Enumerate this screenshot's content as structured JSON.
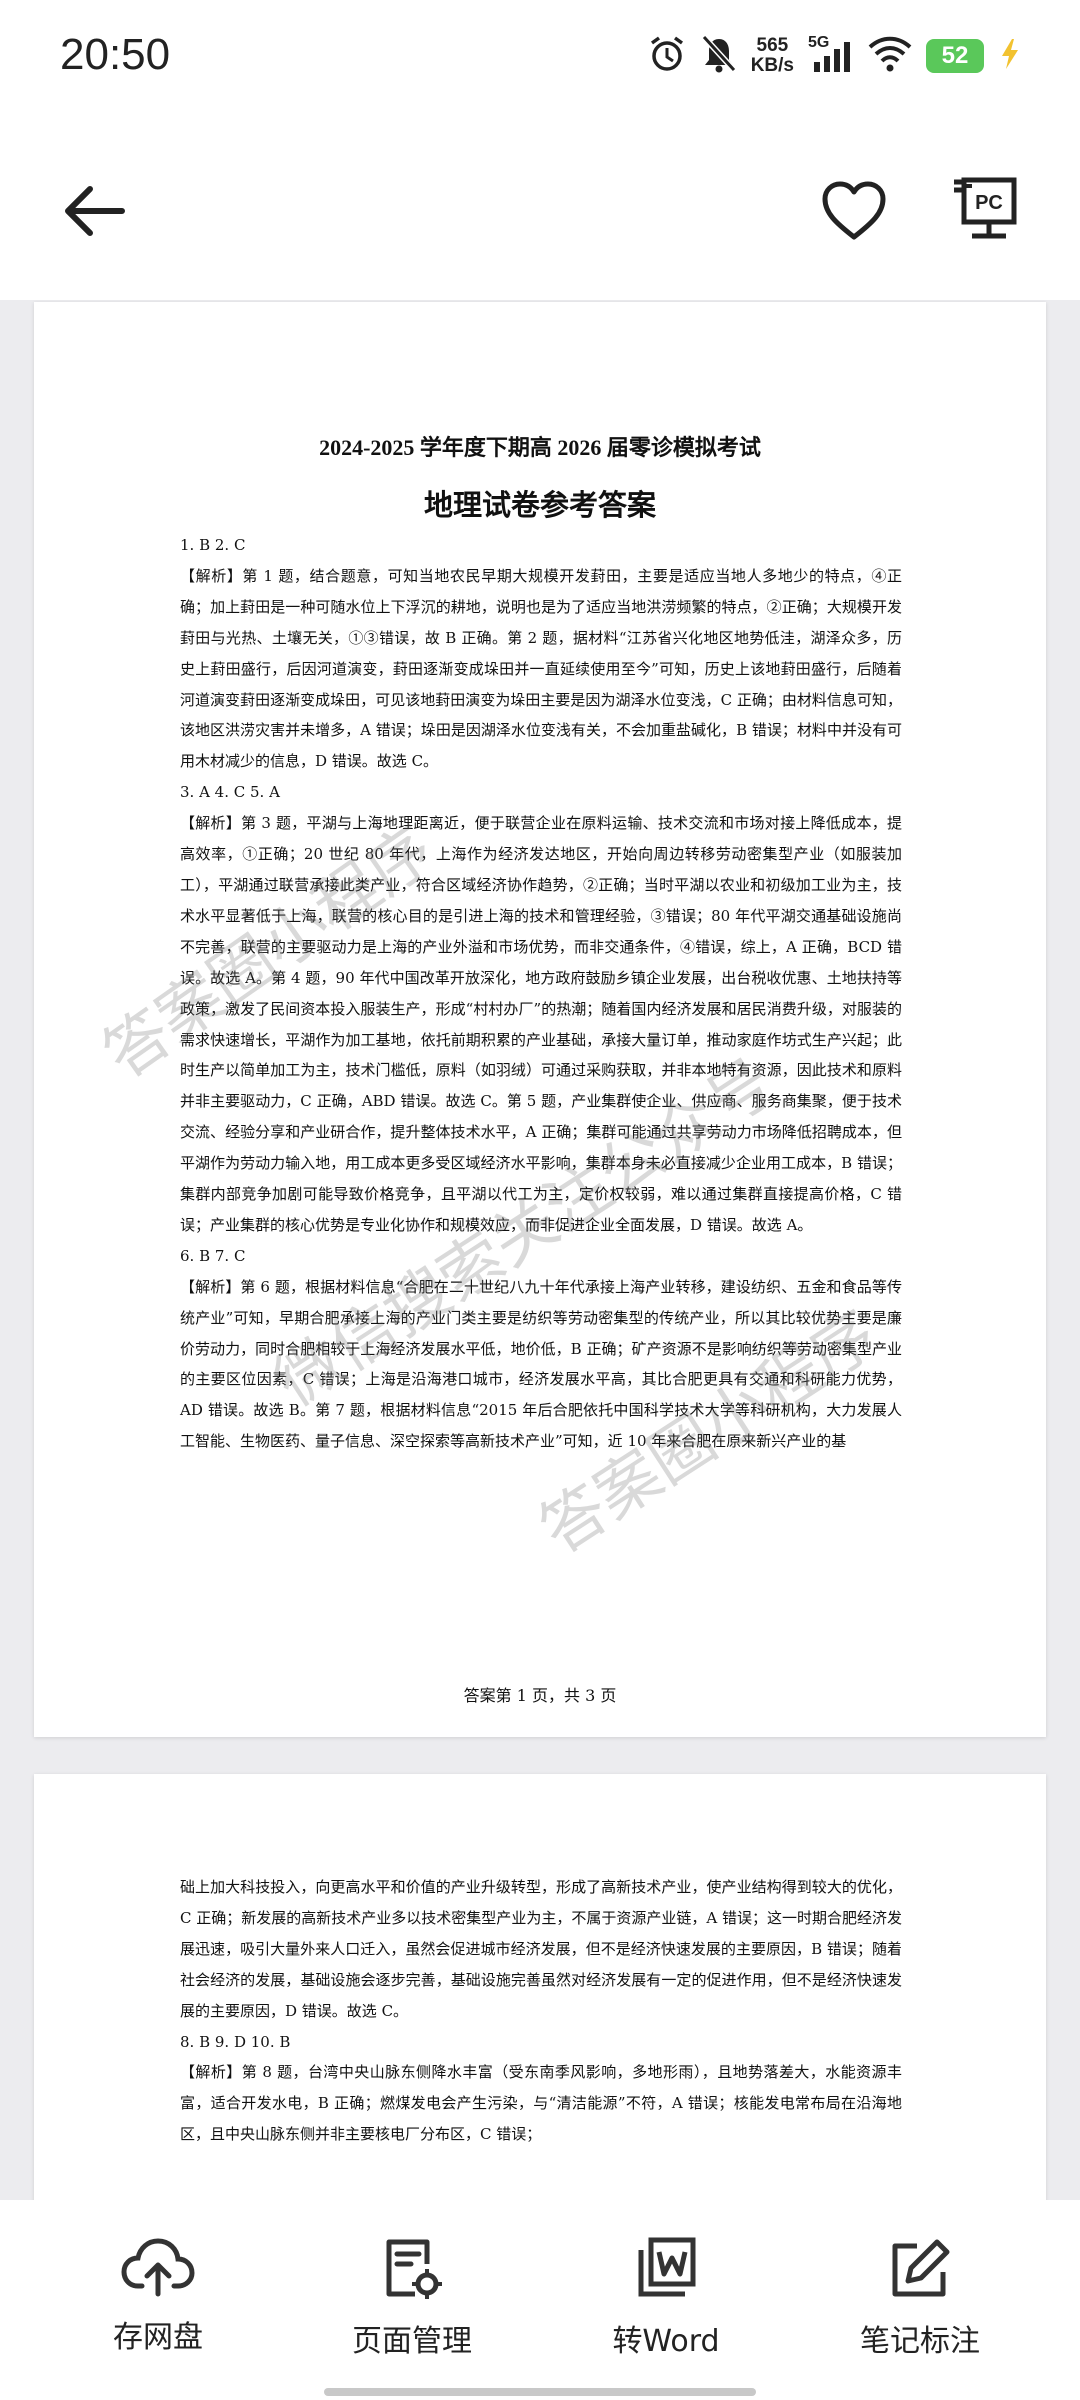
{
  "status_bar": {
    "time": "20:50",
    "net_speed_value": "565",
    "net_speed_unit": "KB/s",
    "network": "5G",
    "battery": "52"
  },
  "document": {
    "page1": {
      "title": "2024-2025 学年度下期高 2026 届零诊模拟考试",
      "subtitle": "地理试卷参考答案",
      "paragraphs": [
        "1. B    2. C",
        "【解析】第 1 题，结合题意，可知当地农民早期大规模开发葑田，主要是适应当地人多地少的特点，④正确；加上葑田是一种可随水位上下浮沉的耕地，说明也是为了适应当地洪涝频繁的特点，②正确；大规模开发葑田与光热、土壤无关，①③错误，故 B 正确。第 2 题，据材料“江苏省兴化地区地势低洼，湖泽众多，历史上葑田盛行，后因河道演变，葑田逐渐变成垛田并一直延续使用至今”可知，历史上该地葑田盛行，后随着河道演变葑田逐渐变成垛田，可见该地葑田演变为垛田主要是因为湖泽水位变浅，C 正确；由材料信息可知，该地区洪涝灾害并未增多，A 错误；垛田是因湖泽水位变浅有关，不会加重盐碱化，B 错误；材料中并没有可用木材减少的信息，D 错误。故选 C。",
        "3. A    4. C    5. A",
        "【解析】第 3 题，平湖与上海地理距离近，便于联营企业在原料运输、技术交流和市场对接上降低成本，提高效率，①正确；20 世纪 80 年代，上海作为经济发达地区，开始向周边转移劳动密集型产业（如服装加工），平湖通过联营承接此类产业，符合区域经济协作趋势，②正确；当时平湖以农业和初级加工业为主，技术水平显著低于上海，联营的核心目的是引进上海的技术和管理经验，③错误；80 年代平湖交通基础设施尚不完善，联营的主要驱动力是上海的产业外溢和市场优势，而非交通条件，④错误，综上，A 正确，BCD 错误。故选 A。第 4 题，90 年代中国改革开放深化，地方政府鼓励乡镇企业发展，出台税收优惠、土地扶持等政策，激发了民间资本投入服装生产，形成“村村办厂”的热潮；随着国内经济发展和居民消费升级，对服装的需求快速增长，平湖作为加工基地，依托前期积累的产业基础，承接大量订单，推动家庭作坊式生产兴起；此时生产以简单加工为主，技术门槛低，原料（如羽绒）可通过采购获取，并非本地特有资源，因此技术和原料并非主要驱动力，C 正确，ABD 错误。故选 C。第 5 题，产业集群使企业、供应商、服务商集聚，便于技术交流、经验分享和产业研合作，提升整体技术水平，A 正确；集群可能通过共享劳动力市场降低招聘成本，但平湖作为劳动力输入地，用工成本更多受区域经济水平影响，集群本身未必直接减少企业用工成本，B 错误；集群内部竞争加剧可能导致价格竞争，且平湖以代工为主，定价权较弱，难以通过集群直接提高价格，C 错误；产业集群的核心优势是专业化协作和规模效应，而非促进企业全面发展，D 错误。故选 A。",
        "6. B    7. C",
        "【解析】第 6 题，根据材料信息“合肥在二十世纪八九十年代承接上海产业转移，建设纺织、五金和食品等传统产业”可知，早期合肥承接上海的产业门类主要是纺织等劳动密集型的传统产业，所以其比较优势主要是廉价劳动力，同时合肥相较于上海经济发展水平低，地价低，B 正确；矿产资源不是影响纺织等劳动密集型产业的主要区位因素，C 错误；上海是沿海港口城市，经济发展水平高，其比合肥更具有交通和科研能力优势，AD 错误。故选 B。第 7 题，根据材料信息“2015 年后合肥依托中国科学技术大学等科研机构，大力发展人工智能、生物医药、量子信息、深空探索等高新技术产业”可知，近 10 年来合肥在原来新兴产业的基"
      ],
      "footer": "答案第 1 页，共 3 页"
    },
    "page2": {
      "paragraphs": [
        "础上加大科技投入，向更高水平和价值的产业升级转型，形成了高新技术产业，使产业结构得到较大的优化，C 正确；新发展的高新技术产业多以技术密集型产业为主，不属于资源产业链，A 错误；这一时期合肥经济发展迅速，吸引大量外来人口迁入，虽然会促进城市经济发展，但不是经济快速发展的主要原因，B 错误；随着社会经济的发展，基础设施会逐步完善，基础设施完善虽然对经济发展有一定的促进作用，但不是经济快速发展的主要原因，D 错误。故选 C。",
        "8. B    9. D    10. B",
        "【解析】第 8 题，台湾中央山脉东侧降水丰富（受东南季风影响，多地形雨），且地势落差大，水能资源丰富，适合开发水电，B 正确；燃煤发电会产生污染，与“清洁能源”不符，A 错误；核能发电常布局在沿海地区，且中央山脉东侧并非主要核电厂分布区，C 错误；"
      ]
    },
    "watermarks": [
      "答案圈小程序",
      "微信搜索关注公众号",
      "答案圈小程序"
    ]
  },
  "toolbar": {
    "items": [
      {
        "label": "存网盘",
        "icon": "cloud-upload-icon"
      },
      {
        "label": "页面管理",
        "icon": "page-settings-icon"
      },
      {
        "label": "转Word",
        "icon": "word-convert-icon"
      },
      {
        "label": "笔记标注",
        "icon": "edit-note-icon"
      }
    ]
  }
}
